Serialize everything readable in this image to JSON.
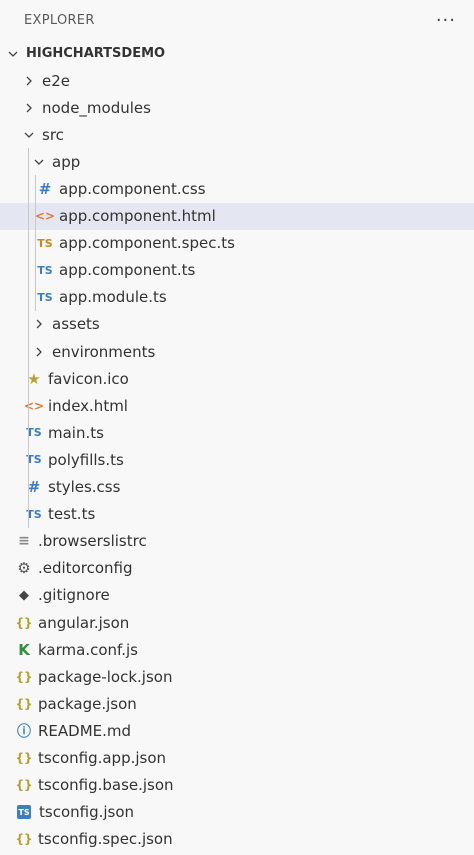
{
  "header": {
    "title": "EXPLORER",
    "more": "···"
  },
  "root": {
    "label": "HIGHCHARTSDEMO"
  },
  "rows": [
    {
      "label": "e2e",
      "kind": "folder",
      "expanded": false,
      "level": 1,
      "icon": "chevron-right-icon"
    },
    {
      "label": "node_modules",
      "kind": "folder",
      "expanded": false,
      "level": 1,
      "icon": "chevron-right-icon"
    },
    {
      "label": "src",
      "kind": "folder",
      "expanded": true,
      "level": 1,
      "icon": "chevron-down-icon"
    },
    {
      "label": "app",
      "kind": "folder",
      "expanded": true,
      "level": 2,
      "icon": "chevron-down-icon"
    },
    {
      "label": "app.component.css",
      "kind": "file",
      "level": 3,
      "icon": "css-hash-icon",
      "glyph": "#"
    },
    {
      "label": "app.component.html",
      "kind": "file",
      "level": 3,
      "icon": "html-brackets-icon",
      "glyph": "<>",
      "selected": true
    },
    {
      "label": "app.component.spec.ts",
      "kind": "file",
      "level": 3,
      "icon": "typescript-spec-icon",
      "glyph": "TS"
    },
    {
      "label": "app.component.ts",
      "kind": "file",
      "level": 3,
      "icon": "typescript-icon",
      "glyph": "TS"
    },
    {
      "label": "app.module.ts",
      "kind": "file",
      "level": 3,
      "icon": "typescript-icon",
      "glyph": "TS"
    },
    {
      "label": "assets",
      "kind": "folder",
      "expanded": false,
      "level": 2,
      "icon": "chevron-right-icon"
    },
    {
      "label": "environments",
      "kind": "folder",
      "expanded": false,
      "level": 2,
      "icon": "chevron-right-icon"
    },
    {
      "label": "favicon.ico",
      "kind": "file",
      "level": 2,
      "icon": "star-icon",
      "glyph": "★"
    },
    {
      "label": "index.html",
      "kind": "file",
      "level": 2,
      "icon": "html-brackets-icon",
      "glyph": "<>"
    },
    {
      "label": "main.ts",
      "kind": "file",
      "level": 2,
      "icon": "typescript-icon",
      "glyph": "TS"
    },
    {
      "label": "polyfills.ts",
      "kind": "file",
      "level": 2,
      "icon": "typescript-icon",
      "glyph": "TS"
    },
    {
      "label": "styles.css",
      "kind": "file",
      "level": 2,
      "icon": "css-hash-icon",
      "glyph": "#"
    },
    {
      "label": "test.ts",
      "kind": "file",
      "level": 2,
      "icon": "typescript-icon",
      "glyph": "TS"
    },
    {
      "label": ".browserslistrc",
      "kind": "file",
      "level": 1,
      "icon": "text-lines-icon",
      "glyph": "≡"
    },
    {
      "label": ".editorconfig",
      "kind": "file",
      "level": 1,
      "icon": "gear-icon",
      "glyph": "⚙"
    },
    {
      "label": ".gitignore",
      "kind": "file",
      "level": 1,
      "icon": "git-icon",
      "glyph": "◆"
    },
    {
      "label": "angular.json",
      "kind": "file",
      "level": 1,
      "icon": "json-braces-icon",
      "glyph": "{}"
    },
    {
      "label": "karma.conf.js",
      "kind": "file",
      "level": 1,
      "icon": "karma-icon",
      "glyph": "K"
    },
    {
      "label": "package-lock.json",
      "kind": "file",
      "level": 1,
      "icon": "json-braces-icon",
      "glyph": "{}"
    },
    {
      "label": "package.json",
      "kind": "file",
      "level": 1,
      "icon": "json-braces-icon",
      "glyph": "{}"
    },
    {
      "label": "README.md",
      "kind": "file",
      "level": 1,
      "icon": "info-icon",
      "glyph": "ⓘ"
    },
    {
      "label": "tsconfig.app.json",
      "kind": "file",
      "level": 1,
      "icon": "json-braces-icon",
      "glyph": "{}"
    },
    {
      "label": "tsconfig.base.json",
      "kind": "file",
      "level": 1,
      "icon": "json-braces-icon",
      "glyph": "{}"
    },
    {
      "label": "tsconfig.json",
      "kind": "file",
      "level": 1,
      "icon": "typescript-config-icon",
      "glyph": "TS"
    },
    {
      "label": "tsconfig.spec.json",
      "kind": "file",
      "level": 1,
      "icon": "json-braces-icon",
      "glyph": "{}"
    }
  ],
  "colors": {
    "background": "#f8f8f8",
    "selected_row": "#e4e6f1",
    "typescript": "#3a7fc4",
    "typescript_spec": "#c9891c",
    "html": "#e37933",
    "json": "#b8a02e",
    "karma": "#2f8f3a"
  }
}
